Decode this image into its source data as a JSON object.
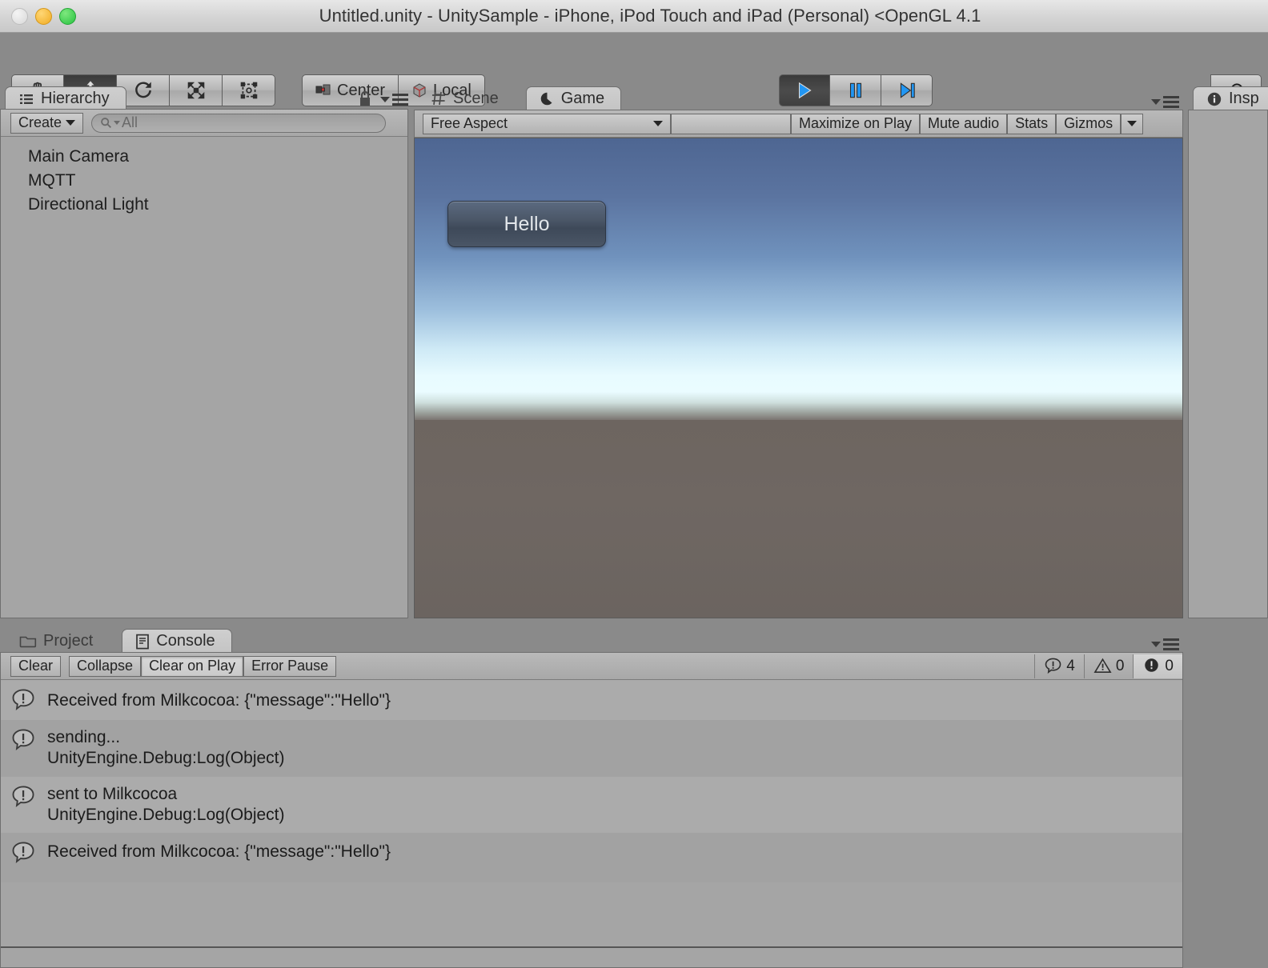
{
  "window": {
    "title": "Untitled.unity - UnitySample - iPhone, iPod Touch and iPad (Personal) <OpenGL 4.1",
    "traffic_lights": [
      "close",
      "minimize",
      "zoom"
    ]
  },
  "toolbar": {
    "tools": [
      {
        "name": "hand-tool",
        "label": "",
        "active": false
      },
      {
        "name": "move-tool",
        "label": "",
        "active": true
      },
      {
        "name": "rotate-tool",
        "label": "",
        "active": false
      },
      {
        "name": "scale-tool",
        "label": "",
        "active": false
      },
      {
        "name": "rect-tool",
        "label": "",
        "active": false
      }
    ],
    "pivot_mode": "Center",
    "rotation_mode": "Local",
    "play": "play-button",
    "pause": "pause-button",
    "step": "step-button",
    "cloud": "cloud-button",
    "play_active": true
  },
  "hierarchy": {
    "tab_label": "Hierarchy",
    "create_label": "Create",
    "search_placeholder": "All",
    "search_value": "",
    "items": [
      {
        "label": "Main Camera"
      },
      {
        "label": "MQTT"
      },
      {
        "label": "Directional Light"
      }
    ]
  },
  "sceneview": {
    "tabs": [
      {
        "label": "Scene",
        "active": false,
        "icon": "grid-icon"
      },
      {
        "label": "Game",
        "active": true,
        "icon": "gamepad-icon"
      }
    ],
    "aspect": "Free Aspect",
    "buttons": [
      {
        "label": "Maximize on Play",
        "name": "maximize-on-play-toggle"
      },
      {
        "label": "Mute audio",
        "name": "mute-audio-toggle"
      },
      {
        "label": "Stats",
        "name": "stats-toggle"
      },
      {
        "label": "Gizmos",
        "name": "gizmos-toggle"
      }
    ],
    "game_button_label": "Hello"
  },
  "inspector": {
    "tab_label": "Insp"
  },
  "console": {
    "tabs": [
      {
        "label": "Project",
        "active": false,
        "icon": "folder-icon"
      },
      {
        "label": "Console",
        "active": true,
        "icon": "console-icon"
      }
    ],
    "buttons": [
      {
        "label": "Clear",
        "name": "clear-button",
        "pressed": false
      },
      {
        "label": "Collapse",
        "name": "collapse-toggle",
        "pressed": false
      },
      {
        "label": "Clear on Play",
        "name": "clear-on-play-toggle",
        "pressed": true
      },
      {
        "label": "Error Pause",
        "name": "error-pause-toggle",
        "pressed": false
      }
    ],
    "counts": {
      "info": "4",
      "warning": "0",
      "error": "0"
    },
    "logs": [
      {
        "message": "Received from Milkcocoa: {\"message\":\"Hello\"}",
        "stack": "",
        "type": "info"
      },
      {
        "message": "sending...",
        "stack": "UnityEngine.Debug:Log(Object)",
        "type": "info"
      },
      {
        "message": "sent to Milkcocoa",
        "stack": "UnityEngine.Debug:Log(Object)",
        "type": "info"
      },
      {
        "message": "Received from Milkcocoa: {\"message\":\"Hello\"}",
        "stack": "",
        "type": "info"
      }
    ]
  },
  "colors": {
    "chrome": "#8a8a8a",
    "panel": "#a5a5a5",
    "accent_blue": "#1e90ff",
    "sky_top": "#4e6692",
    "sky_horizon": "#eafcff",
    "ground": "#6d6560"
  }
}
